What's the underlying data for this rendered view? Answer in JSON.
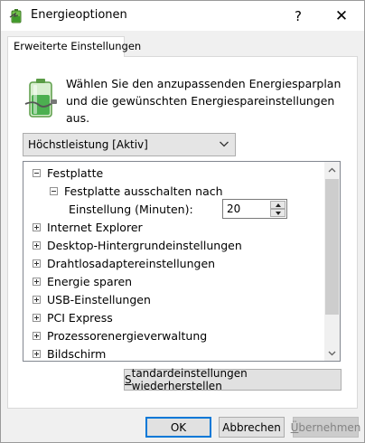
{
  "window": {
    "title": "Energieoptionen",
    "help_symbol": "?",
    "close_symbol": "✕",
    "app_icon": "power-options-icon"
  },
  "tab": {
    "label": "Erweiterte Einstellungen"
  },
  "description": "Wählen Sie den anzupassenden Energiesparplan und die gewünschten Energiespareinstellungen aus.",
  "plan_select": {
    "value": "Höchstleistung [Aktiv]"
  },
  "settings": {
    "festplatte": "Festplatte",
    "ausschalten": "Festplatte ausschalten nach",
    "einstellung_label": "Einstellung (Minuten):",
    "einstellung_value": "20",
    "items": [
      "Internet Explorer",
      "Desktop-Hintergrundeinstellungen",
      "Drahtlosadaptereinstellungen",
      "Energie sparen",
      "USB-Einstellungen",
      "PCI Express",
      "Prozessorenergieverwaltung",
      "Bildschirm"
    ]
  },
  "restore": {
    "prefix": "S",
    "rest": "tandardeinstellungen wiederherstellen"
  },
  "buttons": {
    "ok": "OK",
    "cancel": "Abbrechen",
    "apply_prefix": "Ü",
    "apply_rest": "bernehmen"
  },
  "colors": {
    "accent": "#0078d7",
    "battery_green": "#4caf50"
  }
}
